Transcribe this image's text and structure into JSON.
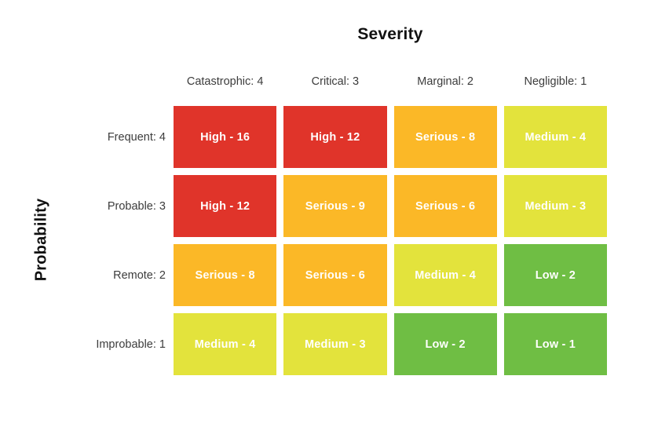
{
  "titles": {
    "severity": "Severity",
    "probability": "Probability"
  },
  "colors": {
    "high": "#E0342A",
    "serious": "#FBB827",
    "medium": "#E3E33C",
    "low": "#6FBE44",
    "background": "#FFFFFF",
    "cell_text": "#FFFFFF",
    "label_text": "#3C3C3C",
    "title_text": "#111111"
  },
  "chart_data": {
    "type": "heatmap",
    "title": "Severity",
    "xlabel": "Severity",
    "ylabel": "Probability",
    "grid": false,
    "legend": "none",
    "categories": [
      "Catastrophic: 4",
      "Critical: 3",
      "Marginal: 2",
      "Negligible: 1"
    ],
    "rows": [
      "Frequent: 4",
      "Probable: 3",
      "Remote: 2",
      "Improbable: 1"
    ],
    "severity_weights": [
      4,
      3,
      2,
      1
    ],
    "probability_weights": [
      4,
      3,
      2,
      1
    ],
    "values": [
      [
        16,
        12,
        8,
        4
      ],
      [
        12,
        9,
        6,
        3
      ],
      [
        8,
        6,
        4,
        2
      ],
      [
        4,
        3,
        2,
        1
      ]
    ],
    "cells": [
      [
        {
          "label": "High - 16",
          "level": "High",
          "score": 16,
          "color": "#E0342A"
        },
        {
          "label": "High - 12",
          "level": "High",
          "score": 12,
          "color": "#E0342A"
        },
        {
          "label": "Serious - 8",
          "level": "Serious",
          "score": 8,
          "color": "#FBB827"
        },
        {
          "label": "Medium - 4",
          "level": "Medium",
          "score": 4,
          "color": "#E3E33C"
        }
      ],
      [
        {
          "label": "High - 12",
          "level": "High",
          "score": 12,
          "color": "#E0342A"
        },
        {
          "label": "Serious - 9",
          "level": "Serious",
          "score": 9,
          "color": "#FBB827"
        },
        {
          "label": "Serious - 6",
          "level": "Serious",
          "score": 6,
          "color": "#FBB827"
        },
        {
          "label": "Medium - 3",
          "level": "Medium",
          "score": 3,
          "color": "#E3E33C"
        }
      ],
      [
        {
          "label": "Serious - 8",
          "level": "Serious",
          "score": 8,
          "color": "#FBB827"
        },
        {
          "label": "Serious - 6",
          "level": "Serious",
          "score": 6,
          "color": "#FBB827"
        },
        {
          "label": "Medium - 4",
          "level": "Medium",
          "score": 4,
          "color": "#E3E33C"
        },
        {
          "label": "Low - 2",
          "level": "Low",
          "score": 2,
          "color": "#6FBE44"
        }
      ],
      [
        {
          "label": "Medium - 4",
          "level": "Medium",
          "score": 4,
          "color": "#E3E33C"
        },
        {
          "label": "Medium - 3",
          "level": "Medium",
          "score": 3,
          "color": "#E3E33C"
        },
        {
          "label": "Low - 2",
          "level": "Low",
          "score": 2,
          "color": "#6FBE44"
        },
        {
          "label": "Low - 1",
          "level": "Low",
          "score": 1,
          "color": "#6FBE44"
        }
      ]
    ]
  }
}
